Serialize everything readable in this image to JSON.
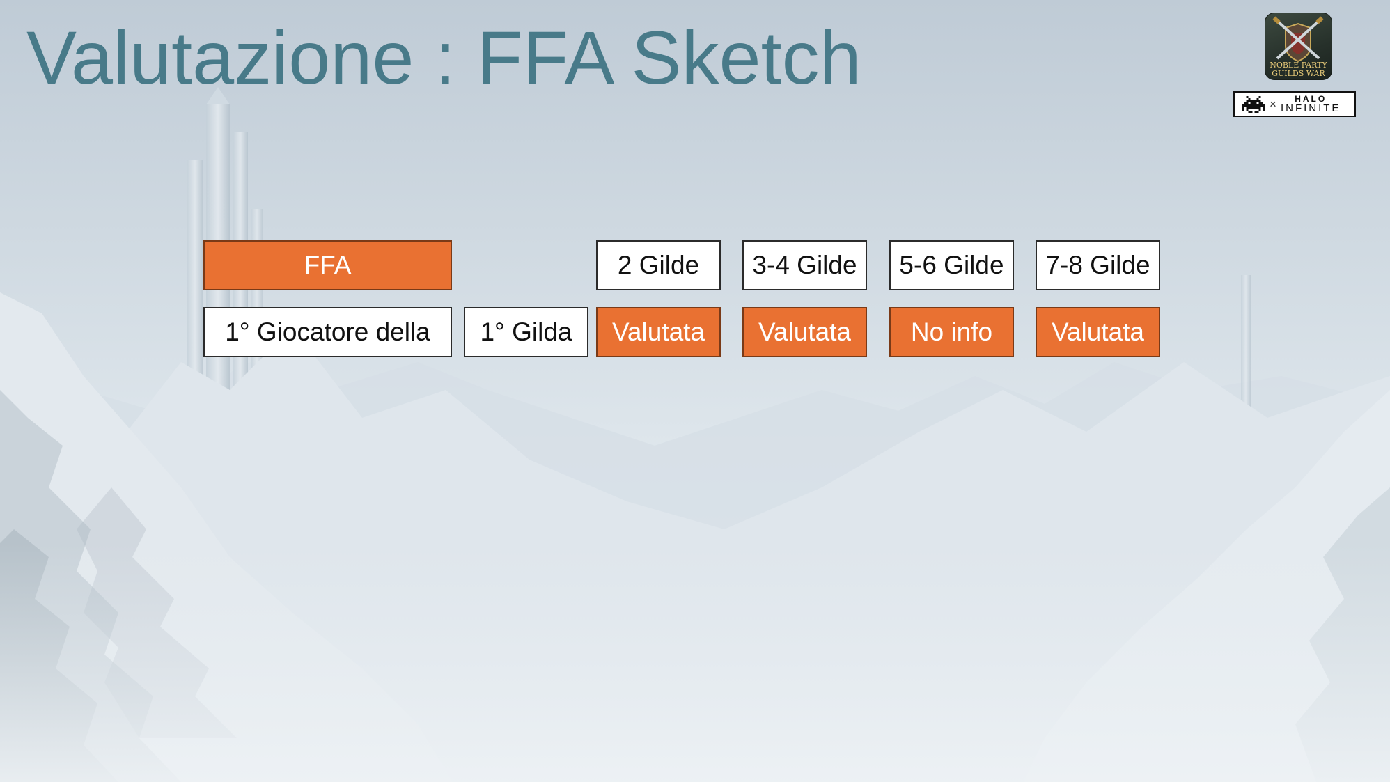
{
  "slide": {
    "title": "Valutazione : FFA Sketch"
  },
  "logo": {
    "line1": "NOBLE PARTY",
    "line2": "GUILDS WAR"
  },
  "collab": {
    "times": "×",
    "brand_top": "HALO",
    "brand_bottom": "INFINITE"
  },
  "table": {
    "header_left": "FFA",
    "headers": [
      "2 Gilde",
      "3-4 Gilde",
      "5-6 Gilde",
      "7-8 Gilde"
    ],
    "row_label": "1° Giocatore della",
    "row_sublabel": "1° Gilda",
    "values": [
      "Valutata",
      "Valutata",
      "No info",
      "Valutata"
    ]
  },
  "colors": {
    "accent": "#e97132",
    "title": "#487a89"
  }
}
